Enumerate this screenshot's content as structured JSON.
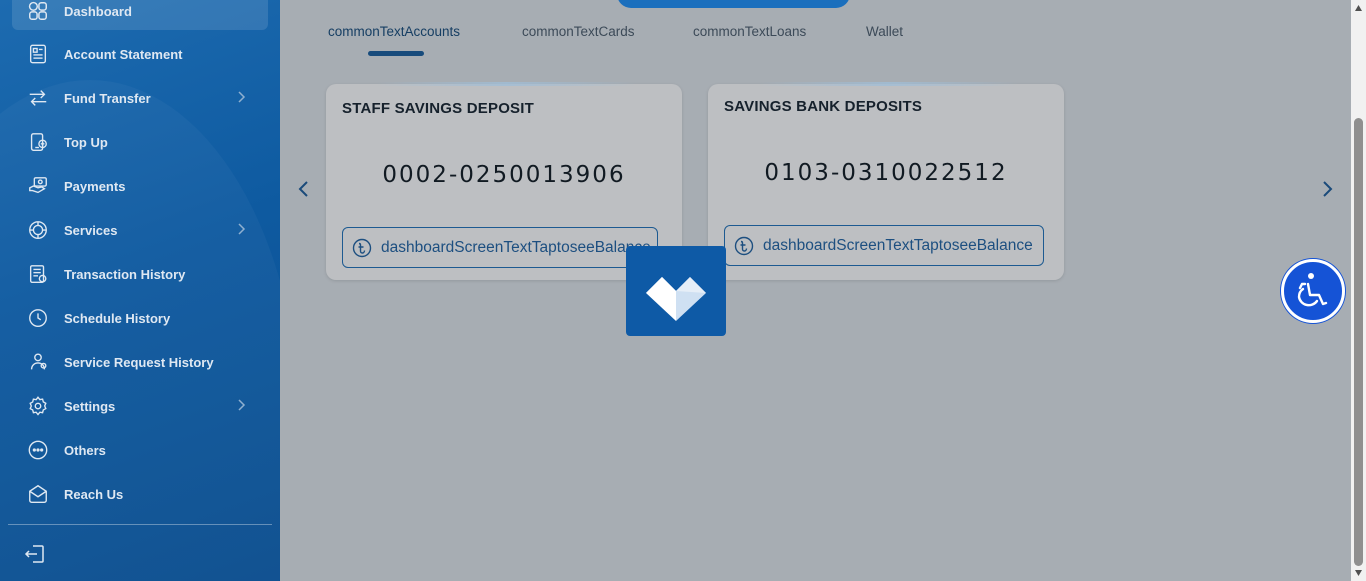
{
  "sidebar": {
    "items": [
      {
        "label": "Dashboard",
        "icon": "grid-icon",
        "active": true
      },
      {
        "label": "Account Statement",
        "icon": "statement-icon"
      },
      {
        "label": "Fund Transfer",
        "icon": "transfer-arrows-icon",
        "has_submenu": true
      },
      {
        "label": "Top Up",
        "icon": "topup-icon"
      },
      {
        "label": "Payments",
        "icon": "payments-icon"
      },
      {
        "label": "Services",
        "icon": "services-icon",
        "has_submenu": true
      },
      {
        "label": "Transaction History",
        "icon": "transaction-history-icon"
      },
      {
        "label": "Schedule History",
        "icon": "clock-icon"
      },
      {
        "label": "Service Request History",
        "icon": "service-request-icon"
      },
      {
        "label": "Settings",
        "icon": "gear-icon",
        "has_submenu": true
      },
      {
        "label": "Others",
        "icon": "more-dots-icon"
      },
      {
        "label": "Reach Us",
        "icon": "reach-us-icon"
      }
    ],
    "logout_icon": "logout-icon"
  },
  "tabs": [
    {
      "label": "commonTextAccounts",
      "active": true
    },
    {
      "label": "commonTextCards"
    },
    {
      "label": "commonTextLoans"
    },
    {
      "label": "Wallet"
    }
  ],
  "accounts": [
    {
      "title": "STAFF SAVINGS DEPOSIT",
      "number": "0002-0250013906",
      "balance_label": "dashboardScreenTextTaptoseeBalance"
    },
    {
      "title": "SAVINGS BANK DEPOSITS",
      "number": "0103-0310022512",
      "balance_label": "dashboardScreenTextTaptoseeBalance"
    }
  ],
  "colors": {
    "sidebar": "#0e5aa0",
    "accent": "#1d5a91",
    "overlay_bg": "#a7adb3",
    "accessibility_button": "#1553d6"
  }
}
